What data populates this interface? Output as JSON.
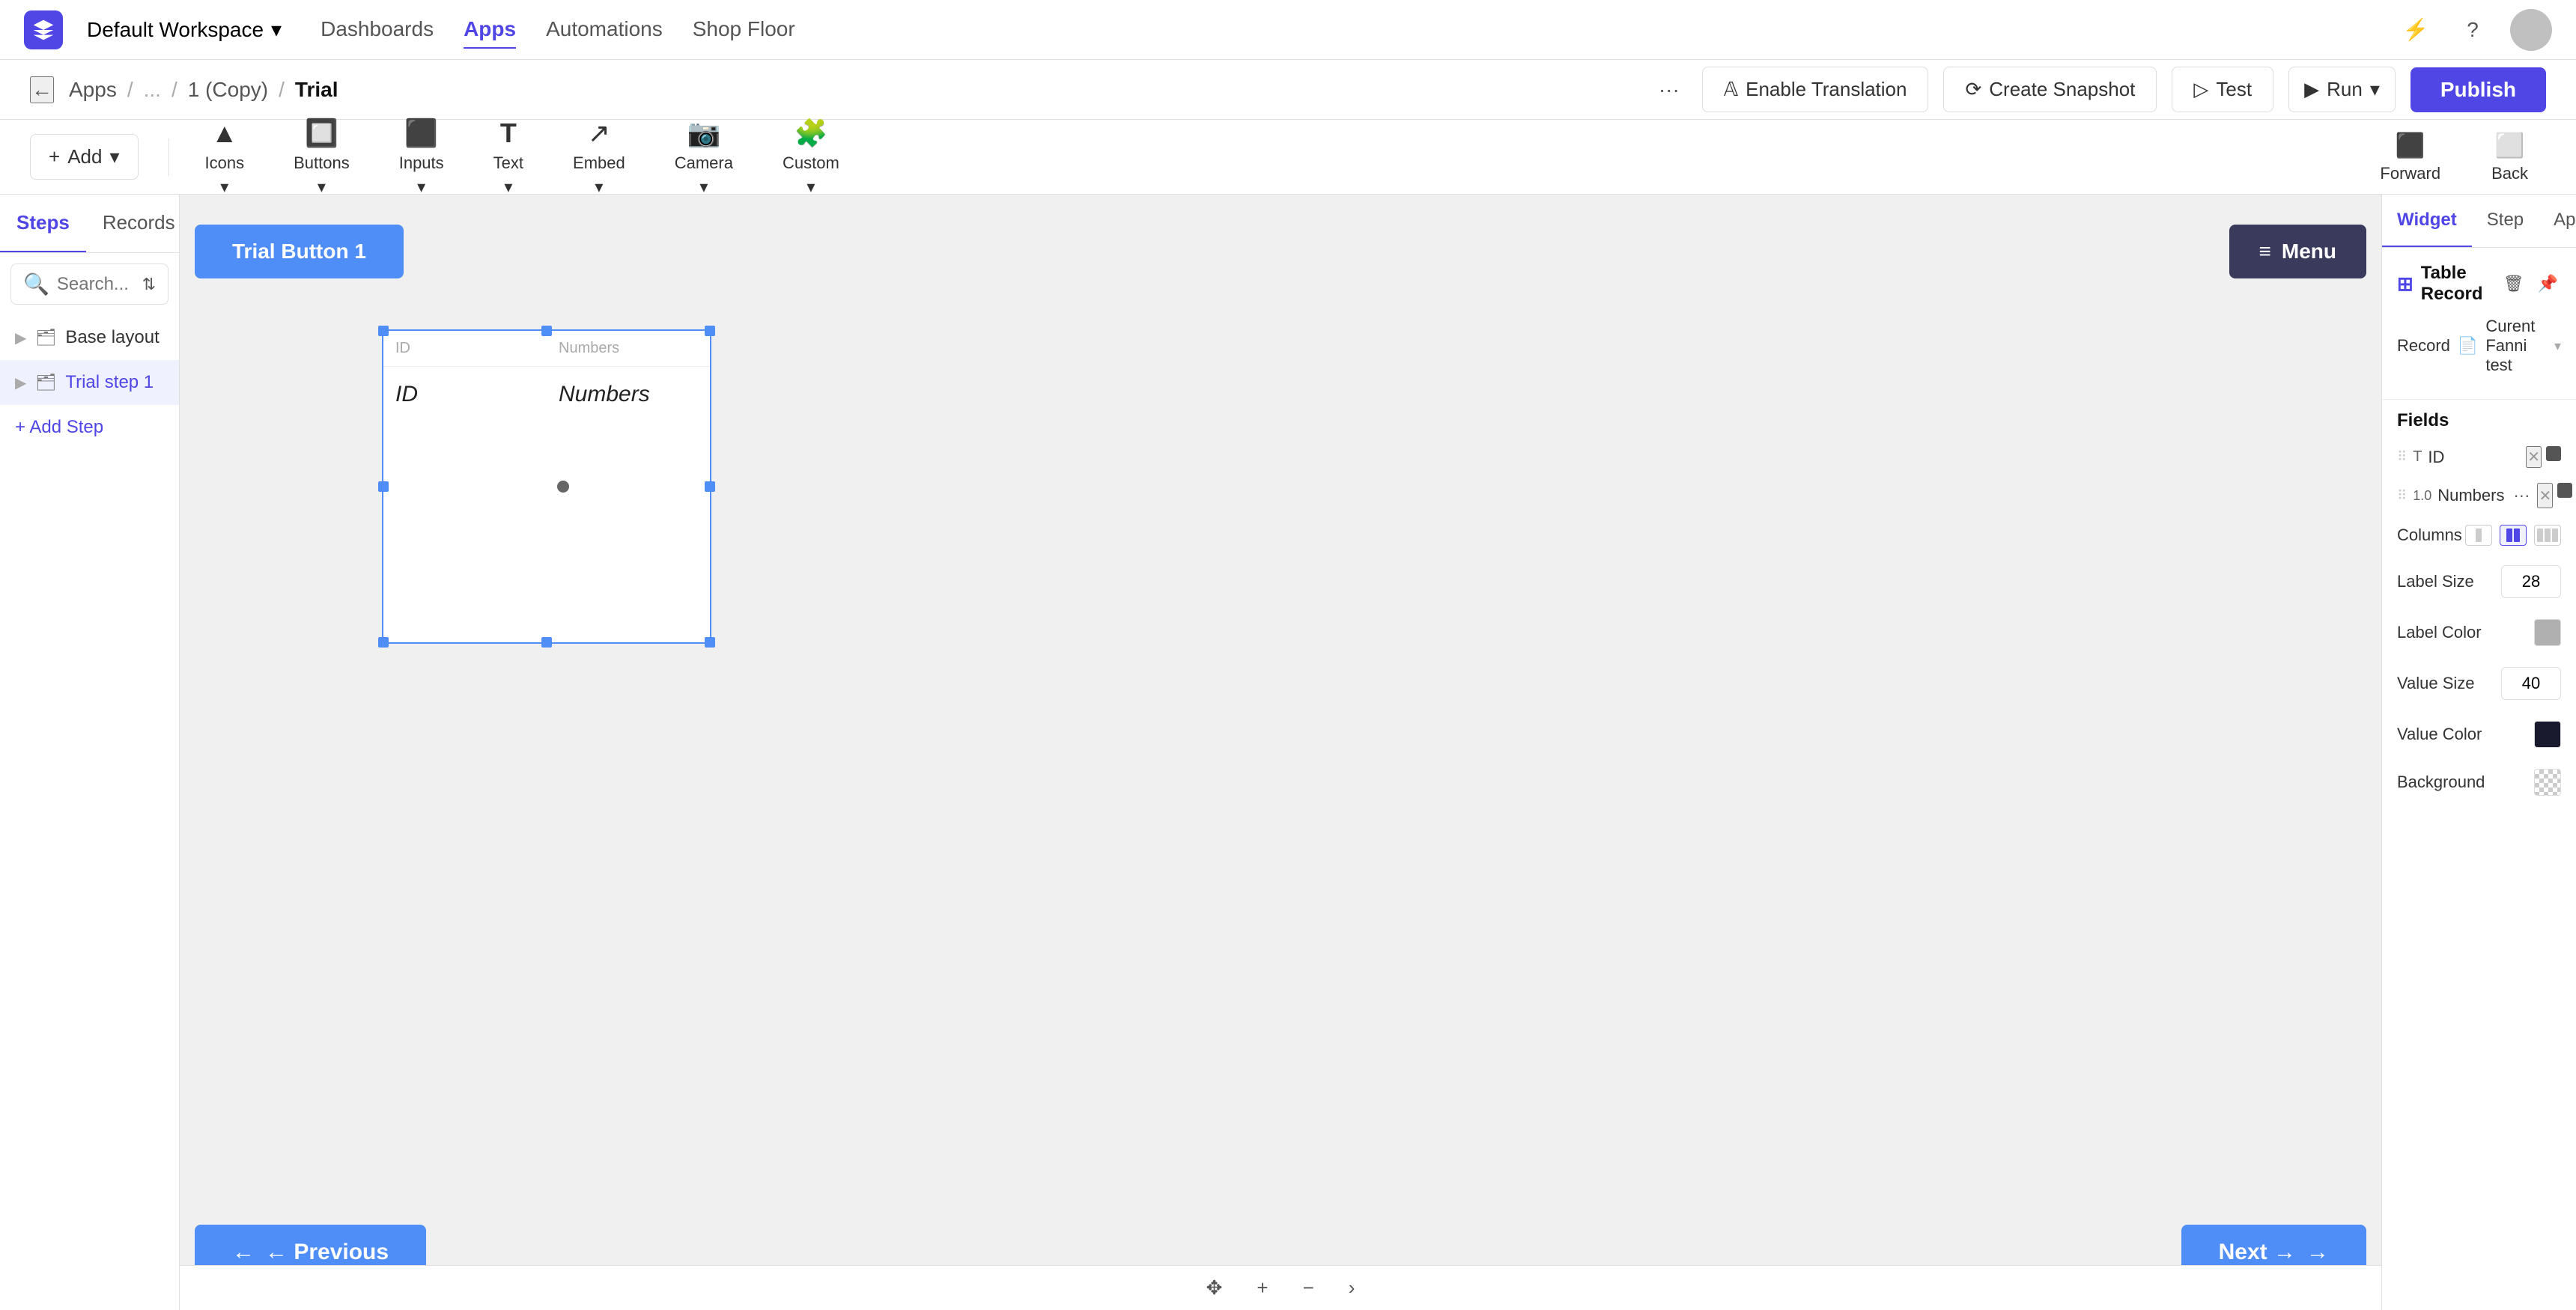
{
  "topNav": {
    "workspace": "Default Workspace",
    "links": [
      "Dashboards",
      "Apps",
      "Automations",
      "Shop Floor"
    ],
    "activeLink": "Apps"
  },
  "breadcrumb": {
    "back": "←",
    "items": [
      "Apps",
      "...",
      "1 (Copy)",
      "Trial"
    ],
    "moreLabel": "···"
  },
  "actions": {
    "moreLabel": "···",
    "enableTranslation": "Enable Translation",
    "createSnapshot": "Create Snapshot",
    "test": "Test",
    "run": "Run",
    "publish": "Publish"
  },
  "toolbar": {
    "addLabel": "Add",
    "tools": [
      {
        "id": "icons",
        "label": "Icons",
        "icon": "▲"
      },
      {
        "id": "buttons",
        "label": "Buttons",
        "icon": "▼"
      },
      {
        "id": "inputs",
        "label": "Inputs",
        "icon": "⬛"
      },
      {
        "id": "text",
        "label": "Text",
        "icon": "T"
      },
      {
        "id": "embed",
        "label": "Embed",
        "icon": "⬜"
      },
      {
        "id": "camera",
        "label": "Camera",
        "icon": "📷"
      },
      {
        "id": "custom",
        "label": "Custom",
        "icon": "🧩"
      }
    ],
    "forward": "Forward",
    "back": "Back"
  },
  "leftPanel": {
    "tabs": [
      "Steps",
      "Records"
    ],
    "activeTab": "Steps",
    "searchPlaceholder": "Search...",
    "treeItems": [
      {
        "id": "base-layout",
        "label": "Base layout",
        "type": "folder"
      },
      {
        "id": "trial-step-1",
        "label": "Trial step 1",
        "type": "folder",
        "active": true
      }
    ],
    "addStepLabel": "+ Add Step"
  },
  "canvas": {
    "trialButtonLabel": "Trial Button 1",
    "menuButtonLabel": "≡ Menu",
    "previousLabel": "← Previous",
    "nextLabel": "Next →",
    "tableWidget": {
      "fields": [
        {
          "label": "ID",
          "value": "ID"
        },
        {
          "label": "Numbers",
          "value": "Numbers"
        }
      ]
    },
    "bottomBar": {
      "moveIcon": "✥",
      "addIcon": "+",
      "minusIcon": "−",
      "arrowIcon": "›"
    }
  },
  "rightPanel": {
    "tabs": [
      "Widget",
      "Step",
      "App"
    ],
    "activeTab": "Widget",
    "widgetType": "Table Record",
    "record": {
      "label": "Record",
      "value": "Curent Fanni test",
      "icon": "📄"
    },
    "fieldsLabel": "Fields",
    "fields": [
      {
        "id": "id-field",
        "name": "ID",
        "typeIcon": "T",
        "typeLabel": "text"
      },
      {
        "id": "numbers-field",
        "name": "Numbers",
        "typeIcon": "1.0",
        "typeLabel": "number"
      }
    ],
    "columns": {
      "label": "Columns",
      "options": [
        "one",
        "two",
        "three"
      ],
      "active": "two"
    },
    "labelSize": {
      "label": "Label Size",
      "value": "28"
    },
    "labelColor": {
      "label": "Label Color"
    },
    "valueSize": {
      "label": "Value Size",
      "value": "40"
    },
    "valueColor": {
      "label": "Value Color"
    },
    "background": {
      "label": "Background"
    }
  }
}
